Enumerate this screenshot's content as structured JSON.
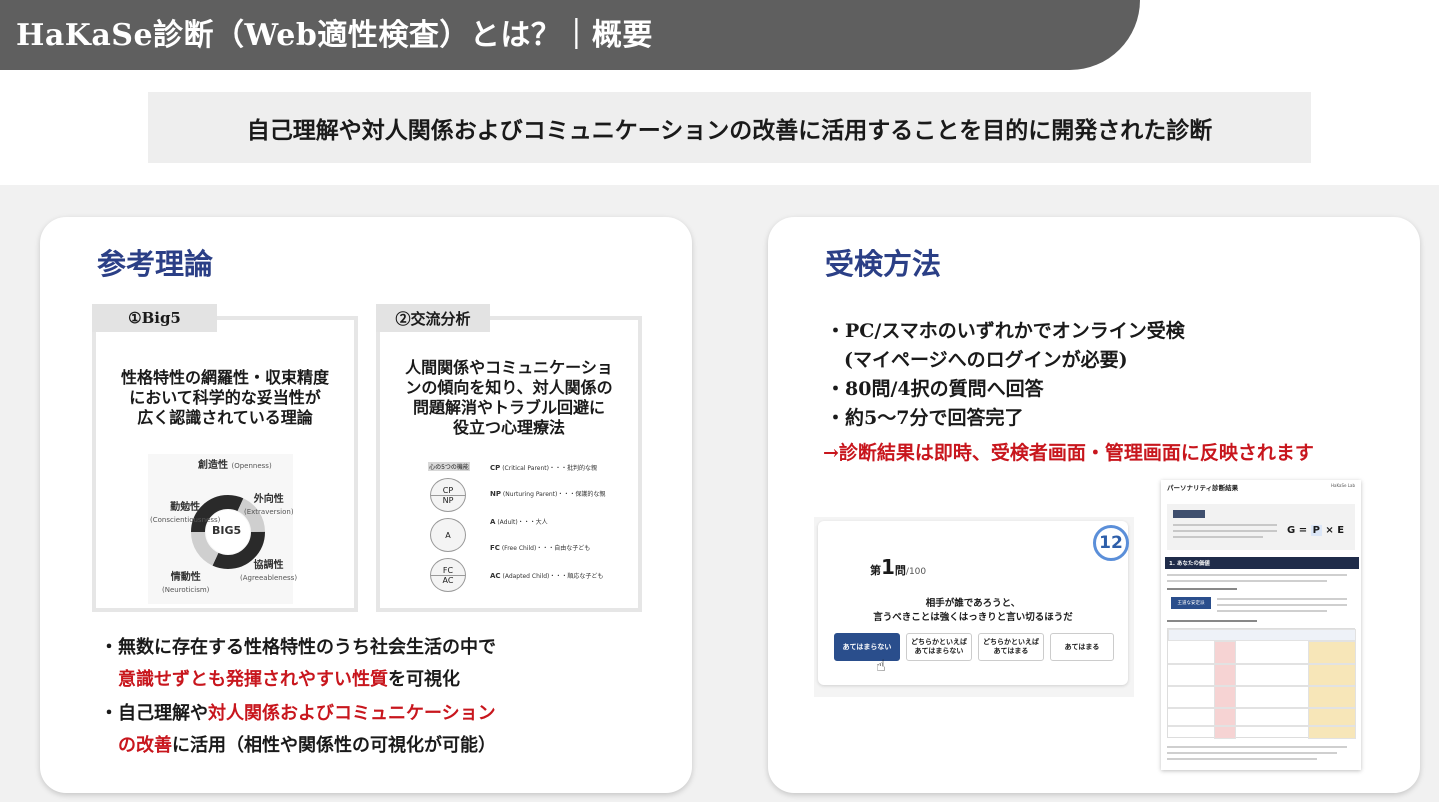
{
  "header": {
    "title": "HaKaSe診断（Web適性検査）とは？｜概要"
  },
  "subtitle": "自己理解や対人関係およびコミュニケーションの改善に活用することを目的に開発された診断",
  "colors": {
    "header_bg": "#5f5f5f",
    "title_blue": "#2b3f86",
    "accent_red": "#c8161d",
    "button_navy": "#2a4e8c"
  },
  "left_card": {
    "title": "参考理論",
    "theory1": {
      "tab": "①Big5",
      "desc": [
        "性格特性の網羅性・収束精度",
        "において科学的な妥当性が",
        "広く認識されている理論"
      ],
      "figure": {
        "center": "BIG5",
        "openness": "創造性",
        "openness_en": "(Openness)",
        "extraversion": "外向性",
        "extraversion_en": "(Extraversion)",
        "conscientiousness": "勤勉性",
        "conscientiousness_en": "(Conscientiousness)",
        "agreeableness": "協調性",
        "agreeableness_en": "(Agreeableness)",
        "neuroticism": "情動性",
        "neuroticism_en": "(Neuroticism)"
      }
    },
    "theory2": {
      "tab": "②交流分析",
      "desc": [
        "人間関係やコミュニケーショ",
        "ンの傾向を知り、対人関係の",
        "問題解消やトラブル回避に",
        "役立つ心理療法"
      ],
      "figure": {
        "head": "心の5つの機能",
        "circles": [
          "CP",
          "NP",
          "A",
          "FC",
          "AC"
        ],
        "items": [
          {
            "title": "CP",
            "sub": "(Critical Parent)・・・批判的な親"
          },
          {
            "title": "NP",
            "sub": "(Nurturing Parent)・・・保護的な親"
          },
          {
            "title": "A",
            "sub": "(Adult)・・・大人"
          },
          {
            "title": "FC",
            "sub": "(Free Child)・・・自由な子ども"
          },
          {
            "title": "AC",
            "sub": "(Adapted Child)・・・順応な子ども"
          }
        ]
      }
    },
    "bullet1": {
      "line1": "・無数に存在する性格特性のうち社会生活の中で",
      "line2_red": "意識せずとも発揮されやすい性質",
      "line2_tail": "を可視化"
    },
    "bullet2": {
      "line1_head": "・自己理解や",
      "line1_red": "対人関係およびコミュニケーション",
      "line2_red": "の改善",
      "line2_tail": "に活用（相性や関係性の可視化が可能）"
    }
  },
  "right_card": {
    "title": "受検方法",
    "items": [
      "・PC/スマホのいずれかでオンライン受検",
      "(マイページへのログインが必要)",
      "・80問/4択の質問へ回答",
      "・約5〜7分で回答完了"
    ],
    "result_note": "→診断結果は即時、受検者画面・管理画面に反映されます",
    "quiz": {
      "badge": "12",
      "num_prefix": "第",
      "num": "1",
      "num_suffix": "問",
      "total": "/100",
      "question1": "相手が誰であろうと、",
      "question2": "言うべきことは強くはっきりと言い切るほうだ",
      "options": [
        "あてはまらない",
        "どちらかといえば\nあてはまらない",
        "どちらかといえば\nあてはまる",
        "あてはまる"
      ]
    },
    "report": {
      "title": "パーソナリティ診断結果",
      "logo": "HaKaSe Lab",
      "section1": "1. あなたの価値",
      "formula_g": "G",
      "formula_p": "P",
      "formula_e": "E",
      "type_label": "王道な安定派"
    }
  }
}
